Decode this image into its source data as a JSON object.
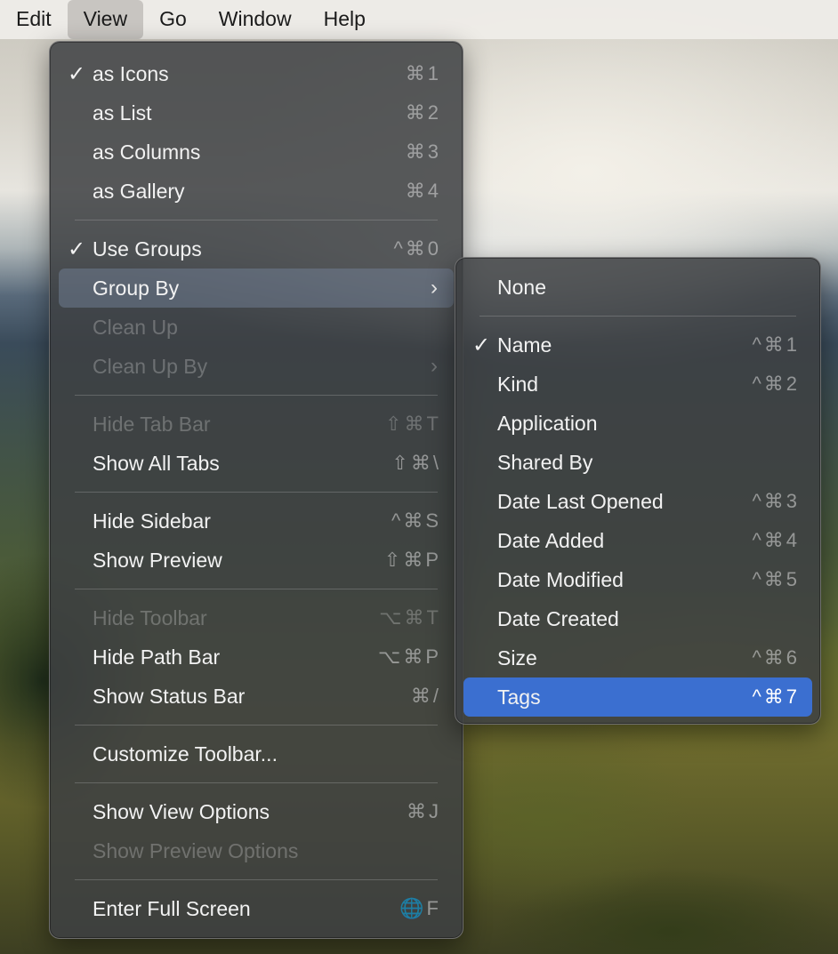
{
  "menubar": {
    "items": [
      "Edit",
      "View",
      "Go",
      "Window",
      "Help"
    ],
    "active": "View"
  },
  "view_menu": {
    "items": [
      {
        "label": "as Icons",
        "shortcut": "⌘1",
        "checked": true
      },
      {
        "label": "as List",
        "shortcut": "⌘2"
      },
      {
        "label": "as Columns",
        "shortcut": "⌘3"
      },
      {
        "label": "as Gallery",
        "shortcut": "⌘4"
      },
      {
        "label": "Use Groups",
        "shortcut": "^⌘0",
        "checked": true
      },
      {
        "label": "Group By",
        "submenu": true,
        "highlighted": true
      },
      {
        "label": "Clean Up",
        "disabled": true
      },
      {
        "label": "Clean Up By",
        "submenu": true,
        "disabled": true
      },
      {
        "label": "Hide Tab Bar",
        "shortcut": "⇧⌘T",
        "disabled": true
      },
      {
        "label": "Show All Tabs",
        "shortcut": "⇧⌘\\"
      },
      {
        "label": "Hide Sidebar",
        "shortcut": "^⌘S"
      },
      {
        "label": "Show Preview",
        "shortcut": "⇧⌘P"
      },
      {
        "label": "Hide Toolbar",
        "shortcut": "⌥⌘T",
        "disabled": true
      },
      {
        "label": "Hide Path Bar",
        "shortcut": "⌥⌘P"
      },
      {
        "label": "Show Status Bar",
        "shortcut": "⌘/"
      },
      {
        "label": "Customize Toolbar..."
      },
      {
        "label": "Show View Options",
        "shortcut": "⌘J"
      },
      {
        "label": "Show Preview Options",
        "disabled": true
      },
      {
        "label": "Enter Full Screen",
        "shortcut": "🌐F"
      }
    ]
  },
  "group_by_menu": {
    "items": [
      {
        "label": "None"
      },
      {
        "label": "Name",
        "shortcut": "^⌘1",
        "checked": true
      },
      {
        "label": "Kind",
        "shortcut": "^⌘2"
      },
      {
        "label": "Application"
      },
      {
        "label": "Shared By"
      },
      {
        "label": "Date Last Opened",
        "shortcut": "^⌘3"
      },
      {
        "label": "Date Added",
        "shortcut": "^⌘4"
      },
      {
        "label": "Date Modified",
        "shortcut": "^⌘5"
      },
      {
        "label": "Date Created"
      },
      {
        "label": "Size",
        "shortcut": "^⌘6"
      },
      {
        "label": "Tags",
        "shortcut": "^⌘7",
        "selected": true
      }
    ]
  },
  "glyphs": {
    "check": "✓",
    "submenu_arrow": "›"
  },
  "colors": {
    "selection": "#3b6fd0",
    "menu_bg": "#3e4042"
  }
}
